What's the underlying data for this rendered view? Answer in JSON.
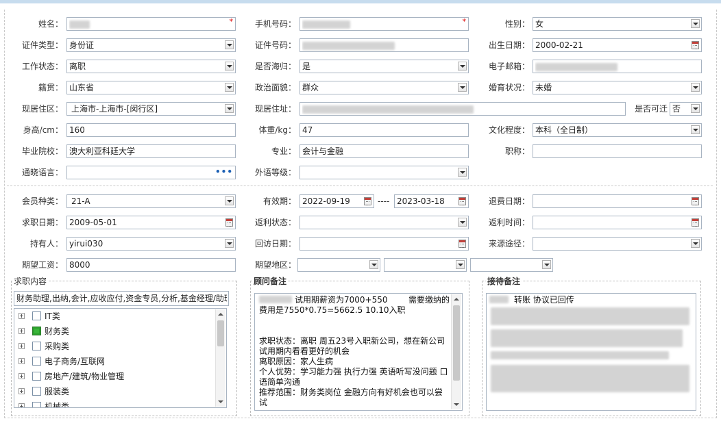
{
  "form": {
    "name": {
      "label": "姓名：",
      "value": ""
    },
    "phone": {
      "label": "手机号码：",
      "value": ""
    },
    "gender": {
      "label": "性别：",
      "value": "女"
    },
    "id_type": {
      "label": "证件类型：",
      "value": "身份证"
    },
    "id_number": {
      "label": "证件号码：",
      "value": ""
    },
    "birth_date": {
      "label": "出生日期：",
      "value": "2000-02-21"
    },
    "work_status": {
      "label": "工作状态：",
      "value": "离职"
    },
    "returnee": {
      "label": "是否海归：",
      "value": "是"
    },
    "email": {
      "label": "电子邮箱：",
      "value": ""
    },
    "native_place": {
      "label": "籍贯：",
      "value": "山东省"
    },
    "political_status": {
      "label": "政治面貌：",
      "value": "群众"
    },
    "marital_status": {
      "label": "婚育状况：",
      "value": "未婚"
    },
    "residence_area": {
      "label": "现居住区：",
      "value": "上海市-上海市-[闵行区]"
    },
    "address": {
      "label": "现居住址：",
      "value": ""
    },
    "relocatable": {
      "label": "是否可迁",
      "value": "否"
    },
    "height": {
      "label": "身高/cm：",
      "value": "160"
    },
    "weight": {
      "label": "体重/kg：",
      "value": "47"
    },
    "education": {
      "label": "文化程度：",
      "value": "本科（全日制）"
    },
    "school": {
      "label": "毕业院校：",
      "value": "澳大利亚科廷大学"
    },
    "major": {
      "label": "专业：",
      "value": "会计与金融"
    },
    "job_title": {
      "label": "职称：",
      "value": ""
    },
    "language": {
      "label": "通晓语言：",
      "value": "",
      "icon": "ellipsis-icon"
    },
    "foreign_level": {
      "label": "外语等级：",
      "value": ""
    }
  },
  "membership": {
    "member_type": {
      "label": "会员种类：",
      "value": "21-A"
    },
    "validity": {
      "label": "有效期：",
      "from": "2022-09-19",
      "sep": "----",
      "to": "2023-03-18"
    },
    "refund_date": {
      "label": "退费日期：",
      "value": ""
    },
    "job_seek_date": {
      "label": "求职日期：",
      "value": "2009-05-01"
    },
    "rebate_status": {
      "label": "返利状态：",
      "value": ""
    },
    "rebate_time": {
      "label": "返利时间：",
      "value": ""
    },
    "holder": {
      "label": "持有人：",
      "value": "yirui030"
    },
    "visit_date": {
      "label": "回访日期：",
      "value": ""
    },
    "source": {
      "label": "来源途径：",
      "value": ""
    },
    "expected_salary": {
      "label": "期望工资：",
      "value": "8000"
    },
    "expected_region": {
      "label": "期望地区：",
      "values": [
        "",
        "",
        ""
      ]
    }
  },
  "job_content": {
    "title": "求职内容",
    "summary": "财务助理,出纳,会计,应收应付,资金专员,分析,基金经理/助理",
    "categories": [
      {
        "label": "IT类",
        "checked": false
      },
      {
        "label": "财务类",
        "checked": true
      },
      {
        "label": "采购类",
        "checked": false
      },
      {
        "label": "电子商务/互联网",
        "checked": false
      },
      {
        "label": "房地产/建筑/物业管理",
        "checked": false
      },
      {
        "label": "服装类",
        "checked": false
      },
      {
        "label": "机械类",
        "checked": false
      }
    ]
  },
  "consultant_notes": {
    "title": "顾问备注",
    "text": "试用期薪资为7000+550        需要缴纳的费用是7550*0.75=5662.5 10.10入职\n\n\n求职状态：离职 周五23号入职新公司，想在新公司试用期内看看更好的机会\n离职原因：家人生病\n个人优势：学习能力强 执行力强 英语听写没问题 口语简单沟通\n推荐范围：财务类岗位 金融方向有好机会也可以尝试"
  },
  "reception_notes": {
    "title": "接待备注",
    "text": "转账 协议已回传"
  }
}
